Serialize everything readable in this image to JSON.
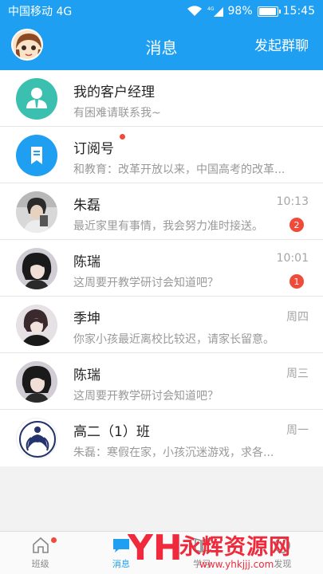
{
  "status_bar": {
    "carrier": "中国移动 4G",
    "network": "4G",
    "battery": "98%",
    "time": "15:45"
  },
  "nav": {
    "title": "消息",
    "action": "发起群聊"
  },
  "conversations": [
    {
      "title": "我的客户经理",
      "subtitle": "有困难请联系我~",
      "time": "",
      "badge": "",
      "icon": "person-icon"
    },
    {
      "title": "订阅号",
      "subtitle": "和教育：改革开放以来，中国高考的改革...",
      "time": "",
      "badge": "",
      "icon": "bookmark-icon"
    },
    {
      "title": "朱磊",
      "subtitle": "最近家里有事情，我会努力准时接送。",
      "time": "10:13",
      "badge": "2"
    },
    {
      "title": "陈瑞",
      "subtitle": "这周要开教学研讨会知道吧？",
      "time": "10:01",
      "badge": "1"
    },
    {
      "title": "季坤",
      "subtitle": "你家小孩最近离校比较迟，请家长留意。",
      "time": "周四",
      "badge": ""
    },
    {
      "title": "陈瑞",
      "subtitle": "这周要开教学研讨会知道吧？",
      "time": "周三",
      "badge": ""
    },
    {
      "title": "高二（1）班",
      "subtitle": "朱磊：寒假在家，小孩沉迷游戏，求各...",
      "time": "周一",
      "badge": ""
    }
  ],
  "tabs": [
    {
      "label": "班级",
      "icon": "home-icon"
    },
    {
      "label": "消息",
      "icon": "chat-icon"
    },
    {
      "label": "学习",
      "icon": "book-icon"
    },
    {
      "label": "发现",
      "icon": "compass-icon"
    }
  ],
  "watermark": {
    "logo_text": "YH",
    "text": "永辉资源网",
    "url": "www.yhkjjj.com"
  },
  "colors": {
    "accent": "#1e9ff2",
    "badge": "#f04b3a",
    "manager_avatar": "#3bbfae",
    "subscription_avatar": "#1e9ff2"
  }
}
